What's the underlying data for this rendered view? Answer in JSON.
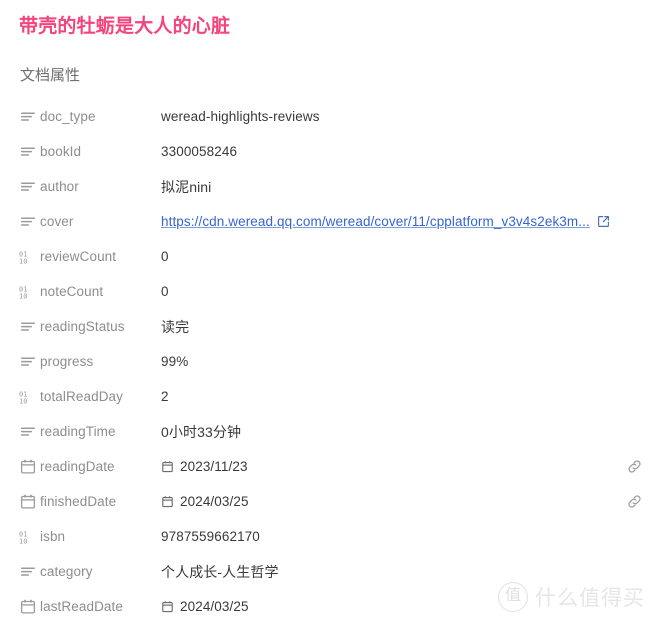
{
  "document": {
    "title": "带壳的牡蛎是大人的心脏",
    "title_color": "#F5437E",
    "section_heading": "文档属性"
  },
  "colors": {
    "title_pink": "#F5437E",
    "label_gray": "#8d8d8d",
    "value_dark": "#393939",
    "link_blue": "#3665CC",
    "icon_gray": "#9b9b9b",
    "watermark_gray": "#e6e6e6"
  },
  "properties": [
    {
      "icon": "text-lines-icon",
      "label": "doc_type",
      "value": "weread-highlights-reviews",
      "type": "text"
    },
    {
      "icon": "text-lines-icon",
      "label": "bookId",
      "value": "3300058246",
      "type": "text"
    },
    {
      "icon": "text-lines-icon",
      "label": "author",
      "value": "拟泥nini",
      "type": "text"
    },
    {
      "icon": "text-lines-icon",
      "label": "cover",
      "value": "https://cdn.weread.qq.com/weread/cover/11/cpplatform_v3v4s2ek3m...",
      "type": "link"
    },
    {
      "icon": "number-icon",
      "label": "reviewCount",
      "value": "0",
      "type": "text"
    },
    {
      "icon": "number-icon",
      "label": "noteCount",
      "value": "0",
      "type": "text"
    },
    {
      "icon": "text-lines-icon",
      "label": "readingStatus",
      "value": "读完",
      "type": "text"
    },
    {
      "icon": "text-lines-icon",
      "label": "progress",
      "value": "99%",
      "type": "text"
    },
    {
      "icon": "number-icon",
      "label": "totalReadDay",
      "value": "2",
      "type": "text"
    },
    {
      "icon": "text-lines-icon",
      "label": "readingTime",
      "value": "0小时33分钟",
      "type": "text"
    },
    {
      "icon": "calendar-icon",
      "label": "readingDate",
      "value": "2023/11/23",
      "type": "date",
      "row_action": "link-icon"
    },
    {
      "icon": "calendar-icon",
      "label": "finishedDate",
      "value": "2024/03/25",
      "type": "date",
      "row_action": "link-icon"
    },
    {
      "icon": "number-icon",
      "label": "isbn",
      "value": "9787559662170",
      "type": "text"
    },
    {
      "icon": "text-lines-icon",
      "label": "category",
      "value": "个人成长-人生哲学",
      "type": "text"
    },
    {
      "icon": "calendar-icon",
      "label": "lastReadDate",
      "value": "2024/03/25",
      "type": "date"
    }
  ],
  "watermark": {
    "badge": "值",
    "text": "什么值得买"
  }
}
